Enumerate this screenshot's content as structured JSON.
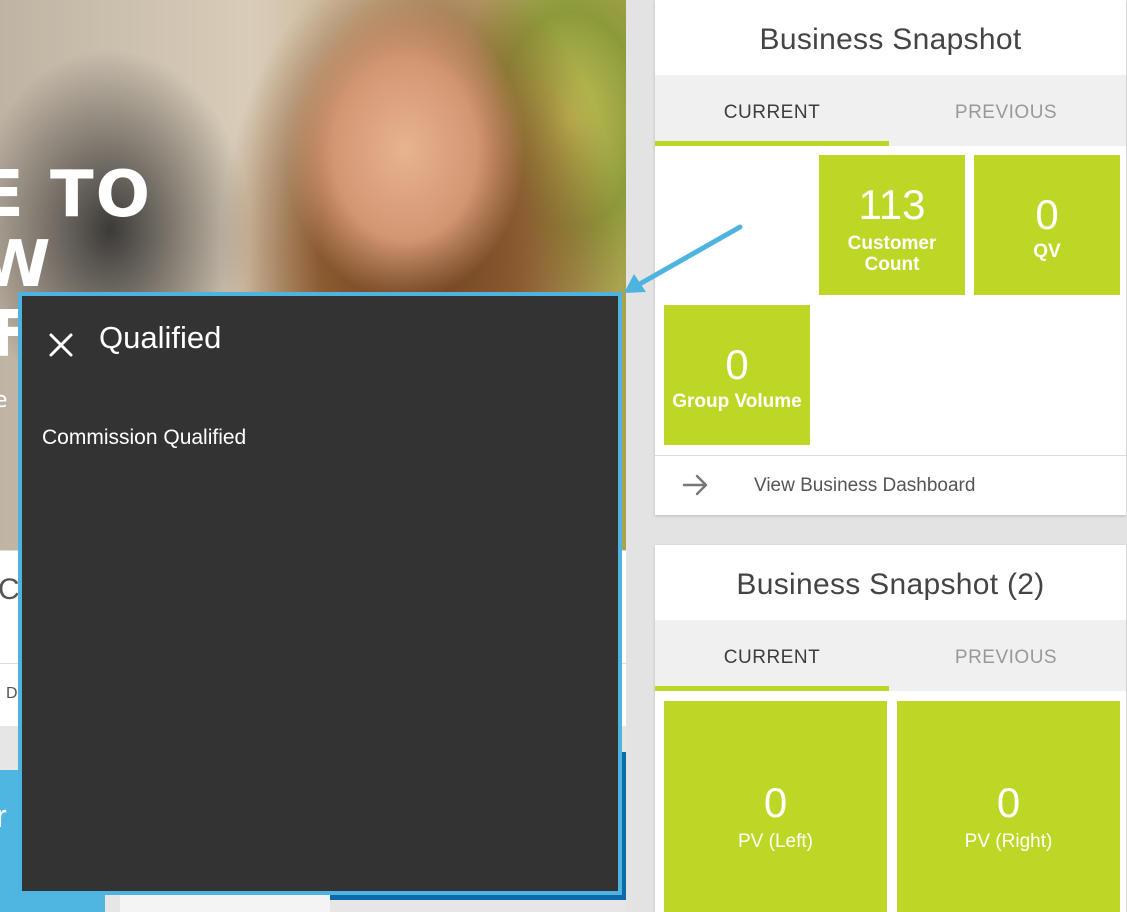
{
  "hero": {
    "line1": "E TO",
    "line2": "W",
    "line3": "FI",
    "line4": "e"
  },
  "left_card": {
    "title": "C",
    "sub": "D"
  },
  "left_blue_char": "r",
  "popup": {
    "title": "Qualified",
    "body": "Commission Qualified",
    "close_icon": "close-icon"
  },
  "snapshot1": {
    "title": "Business Snapshot",
    "tabs": [
      "CURRENT",
      "PREVIOUS"
    ],
    "tiles": [
      {
        "value": "113",
        "label_line1": "Customer",
        "label_line2": "Count"
      },
      {
        "value": "0",
        "label_line1": "QV",
        "label_line2": ""
      },
      {
        "value": "0",
        "label_line1": "Group Volume",
        "label_line2": ""
      }
    ],
    "link_label": "View Business Dashboard"
  },
  "snapshot2": {
    "title": "Business Snapshot (2)",
    "tabs": [
      "CURRENT",
      "PREVIOUS"
    ],
    "tiles": [
      {
        "value": "0",
        "label": "PV (Left)"
      },
      {
        "value": "0",
        "label": "PV (Right)"
      }
    ]
  },
  "colors": {
    "accent_green": "#bed726",
    "popup_bg": "#333333",
    "popup_border": "#4db4e0"
  }
}
